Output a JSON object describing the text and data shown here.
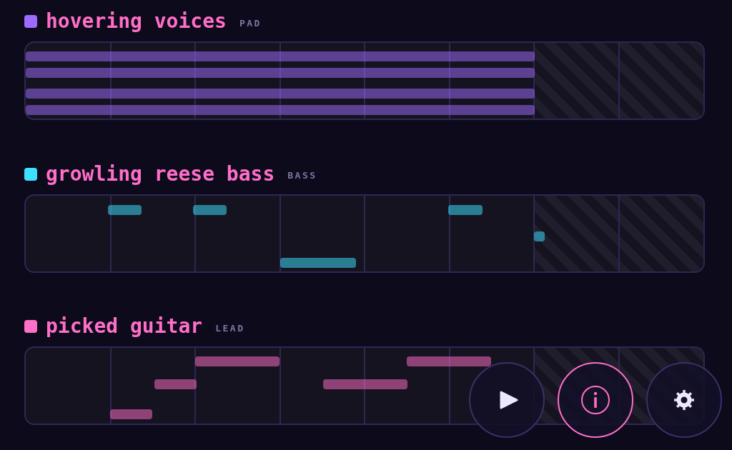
{
  "tracks": [
    {
      "name": "hovering voices",
      "tag": "PAD",
      "color": "#9d6bff"
    },
    {
      "name": "growling reese bass",
      "tag": "BASS",
      "color": "#3ee0ff"
    },
    {
      "name": "picked guitar",
      "tag": "LEAD",
      "color": "#ff6ec7"
    }
  ],
  "buttons": [
    {
      "kind": "play",
      "selected": false
    },
    {
      "kind": "info",
      "selected": true
    },
    {
      "kind": "settings",
      "selected": false
    }
  ]
}
